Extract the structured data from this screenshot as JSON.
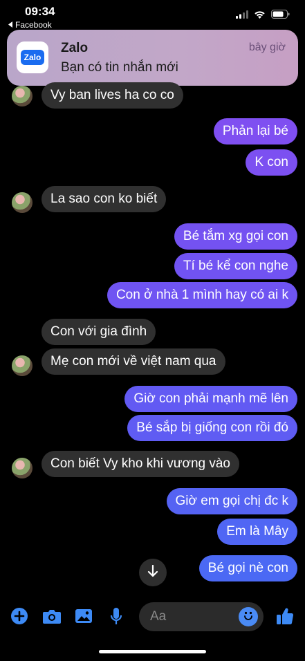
{
  "status_bar": {
    "time": "09:34",
    "back_app": "Facebook"
  },
  "notification": {
    "app_name": "Zalo",
    "app_icon_text": "Zalo",
    "time": "bây giờ",
    "message": "Bạn có tin nhắn mới"
  },
  "colors": {
    "outgoing_top": "#8a4cf0",
    "outgoing_mid": "#6a55f2",
    "outgoing_bottom": "#3d72f5",
    "incoming": "#303030",
    "accent": "#3d8af5"
  },
  "messages": [
    {
      "dir": "in",
      "text": "Vy ban lives ha co co",
      "avatar": true
    },
    {
      "dir": "out",
      "text": "Phản lại bé"
    },
    {
      "dir": "out",
      "text": "K con"
    },
    {
      "dir": "in",
      "text": "La sao con ko biết",
      "avatar": true
    },
    {
      "dir": "out",
      "text": "Bé tắm xg gọi con"
    },
    {
      "dir": "out",
      "text": "Tí bé kể con nghe"
    },
    {
      "dir": "out",
      "text": "Con ở nhà 1 mình hay có ai k"
    },
    {
      "dir": "in",
      "text": "Con với gia đình",
      "avatar": false
    },
    {
      "dir": "in",
      "text": "Mẹ con mới về việt nam qua",
      "avatar": true
    },
    {
      "dir": "out",
      "text": "Giờ con phải mạnh mẽ lên"
    },
    {
      "dir": "out",
      "text": "Bé sắp bị giống con rồi đó"
    },
    {
      "dir": "in",
      "text": "Con biết Vy kho khi vương vào",
      "avatar": true
    },
    {
      "dir": "out",
      "text": "Giờ em gọi chị đc k"
    },
    {
      "dir": "out",
      "text": "Em là Mây"
    },
    {
      "dir": "out",
      "text": "Bé gọi nè con"
    }
  ],
  "composer": {
    "placeholder": "Aa",
    "icons": [
      "plus-icon",
      "camera-icon",
      "photo-icon",
      "microphone-icon",
      "emoji-icon",
      "thumbs-up-icon"
    ]
  }
}
